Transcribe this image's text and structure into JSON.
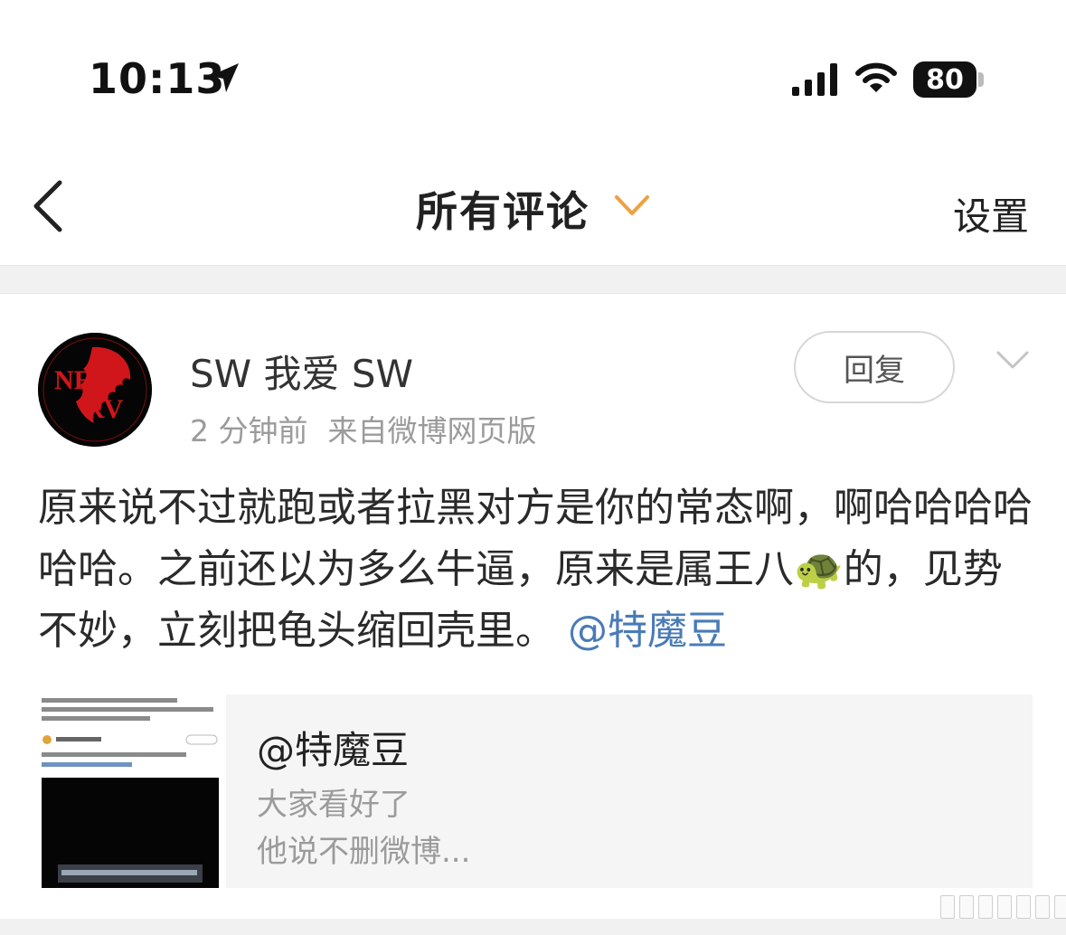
{
  "status_bar": {
    "time": "10:13",
    "battery": "80",
    "icons": [
      "location-arrow-icon",
      "signal-bars-icon",
      "wifi-icon",
      "battery-icon"
    ]
  },
  "nav": {
    "title": "所有评论",
    "settings_label": "设置",
    "accent_color": "#f0a040"
  },
  "comment": {
    "username": "SW 我爱 SW",
    "time_ago": "2 分钟前",
    "source": "来自微博网页版",
    "reply_label": "回复",
    "avatar_logo_text": "NERV",
    "text_before_mention": "原来说不过就跑或者拉黑对方是你的常态啊，啊哈哈哈哈哈哈。之前还以为多么牛逼，原来是属王八🐢的，见势不妙，立刻把龟头缩回壳里。 ",
    "mention": "@特魔豆",
    "mention_color": "#4a7bb7"
  },
  "linked_card": {
    "mention": "@特魔豆",
    "desc_line1": "大家看好了",
    "desc_line2": "他说不删微博..."
  }
}
